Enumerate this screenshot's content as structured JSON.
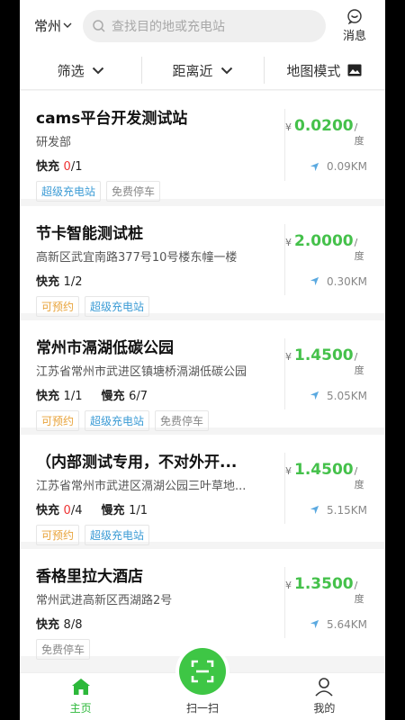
{
  "header": {
    "city": "常州",
    "search_placeholder": "查找目的地或充电站",
    "message_label": "消息"
  },
  "filters": [
    {
      "label": "筛选"
    },
    {
      "label": "距离近"
    },
    {
      "label": "地图模式"
    }
  ],
  "stations": [
    {
      "name": "cams平台开发测试站",
      "address": "研发部",
      "fast_label": "快充",
      "fast_used": "0",
      "fast_total": "/1",
      "slow_label": "",
      "slow_value": "",
      "tags": [
        {
          "text": "超级充电站",
          "color": "blue"
        },
        {
          "text": "免费停车",
          "color": "gray"
        }
      ],
      "currency": "¥",
      "price": "0.0200",
      "unit": "/度",
      "distance": "0.09KM"
    },
    {
      "name": "节卡智能测试桩",
      "address": "高新区武宜南路377号10号楼东幢一楼",
      "fast_label": "快充",
      "fast_used": "",
      "fast_total": "1/2",
      "slow_label": "",
      "slow_value": "",
      "tags": [
        {
          "text": "可预约",
          "color": "orange"
        },
        {
          "text": "超级充电站",
          "color": "blue"
        }
      ],
      "currency": "¥",
      "price": "2.0000",
      "unit": "/度",
      "distance": "0.30KM"
    },
    {
      "name": "常州市滆湖低碳公园",
      "address": "江苏省常州市武进区镇塘桥滆湖低碳公园",
      "fast_label": "快充",
      "fast_used": "",
      "fast_total": "1/1",
      "slow_label": "慢充",
      "slow_value": "6/7",
      "tags": [
        {
          "text": "可预约",
          "color": "orange"
        },
        {
          "text": "超级充电站",
          "color": "blue"
        },
        {
          "text": "免费停车",
          "color": "gray"
        }
      ],
      "currency": "¥",
      "price": "1.4500",
      "unit": "/度",
      "distance": "5.05KM"
    },
    {
      "name": "（内部测试专用，不对外开...",
      "address": "江苏省常州市武进区滆湖公园三叶草地...",
      "fast_label": "快充",
      "fast_used": "0",
      "fast_total": "/4",
      "slow_label": "慢充",
      "slow_value": "1/1",
      "tags": [
        {
          "text": "可预约",
          "color": "orange"
        },
        {
          "text": "超级充电站",
          "color": "blue"
        }
      ],
      "currency": "¥",
      "price": "1.4500",
      "unit": "/度",
      "distance": "5.15KM"
    },
    {
      "name": "香格里拉大酒店",
      "address": "常州武进高新区西湖路2号",
      "fast_label": "快充",
      "fast_used": "",
      "fast_total": "8/8",
      "slow_label": "",
      "slow_value": "",
      "tags": [
        {
          "text": "免费停车",
          "color": "gray"
        }
      ],
      "currency": "¥",
      "price": "1.3500",
      "unit": "/度",
      "distance": "5.64KM"
    }
  ],
  "tabbar": {
    "home": "主页",
    "scan": "扫一扫",
    "mine": "我的"
  },
  "colors": {
    "accent_green": "#45c14b",
    "tag_blue": "#3b9bd5",
    "tag_orange": "#e8a33a",
    "warn_red": "#e33"
  }
}
